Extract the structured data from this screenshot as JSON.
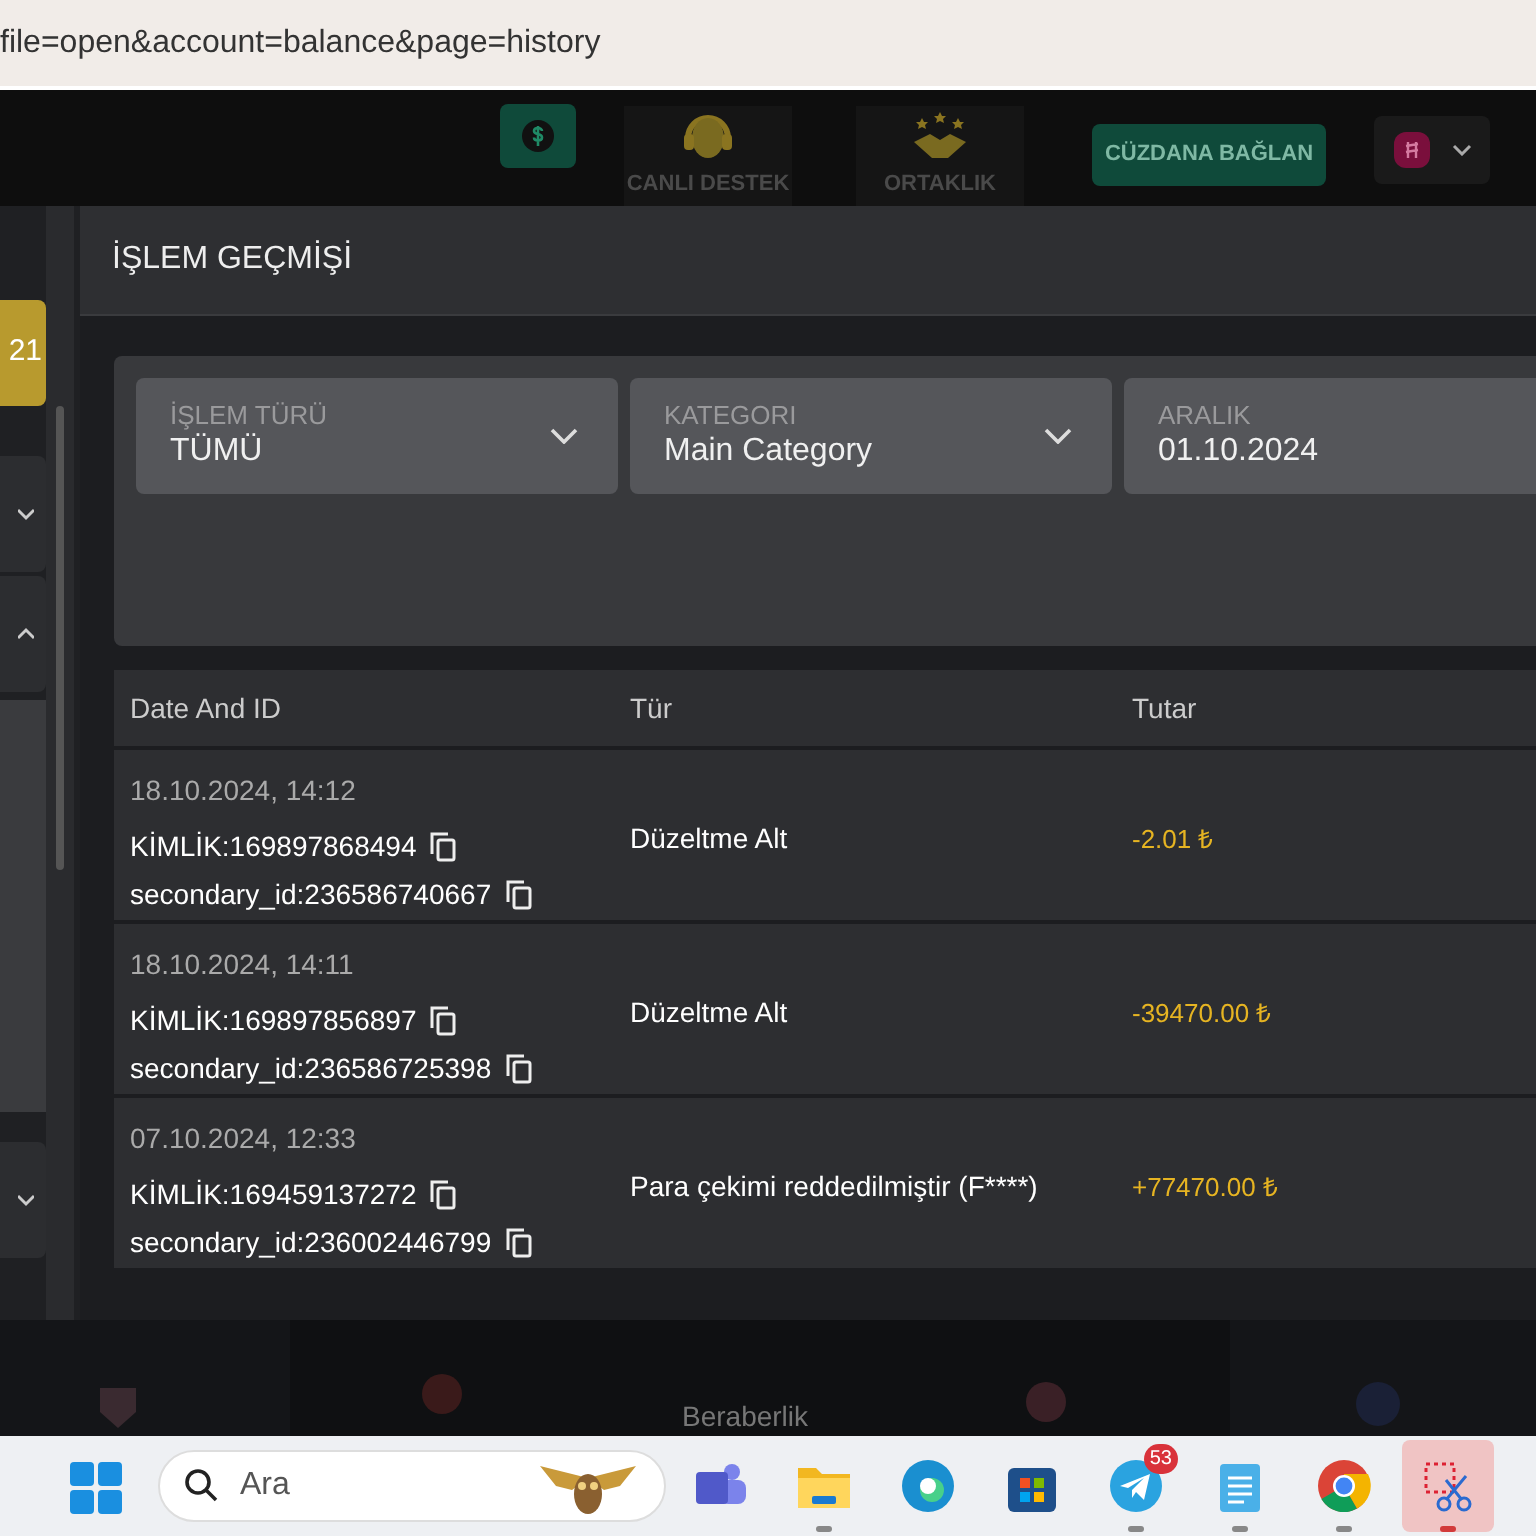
{
  "address_bar": {
    "url": "file=open&account=balance&page=history"
  },
  "header": {
    "nav": [
      {
        "kind": "support",
        "label": "CANLI DESTEK"
      },
      {
        "kind": "partner",
        "label": "ORTAKLIK"
      }
    ],
    "wallet_button": "CÜZDANA BAĞLAN"
  },
  "sidebar": {
    "items": [
      {
        "kind": "highlight",
        "label": "21"
      },
      {
        "kind": "group",
        "expanded": false
      },
      {
        "kind": "group",
        "expanded": true
      },
      {
        "kind": "group",
        "expanded": false
      }
    ]
  },
  "page_title": "İŞLEM GEÇMİŞİ",
  "filters": [
    {
      "kind": "select",
      "label": "İŞLEM TÜRÜ",
      "value": "TÜMÜ"
    },
    {
      "kind": "select",
      "label": "KATEGORI",
      "value": "Main Category"
    },
    {
      "kind": "date",
      "label": "ARALIK",
      "value": "01.10.2024"
    }
  ],
  "table": {
    "columns": [
      "Date And ID",
      "Tür",
      "Tutar"
    ],
    "rows": [
      {
        "date": "18.10.2024, 14:12",
        "id": "KİMLİK:169897868494",
        "secondary_id": "secondary_id:236586740667",
        "type": "Düzeltme Alt",
        "amount": "-2.01 ₺"
      },
      {
        "date": "18.10.2024, 14:11",
        "id": "KİMLİK:169897856897",
        "secondary_id": "secondary_id:236586725398",
        "type": "Düzeltme Alt",
        "amount": "-39470.00 ₺"
      },
      {
        "date": "07.10.2024, 12:33",
        "id": "KİMLİK:169459137272",
        "secondary_id": "secondary_id:236002446799",
        "type": "Para çekimi reddedilmiştir (F****)",
        "amount": "+77470.00 ₺"
      }
    ]
  },
  "match_strip": {
    "label": "Beraberlik"
  },
  "taskbar": {
    "search_placeholder": "Ara",
    "apps": [
      {
        "kind": "teams",
        "running": false,
        "selected": false
      },
      {
        "kind": "files",
        "running": true,
        "selected": false
      },
      {
        "kind": "edge",
        "running": false,
        "selected": false
      },
      {
        "kind": "store",
        "running": false,
        "selected": false
      },
      {
        "kind": "telegram",
        "running": true,
        "selected": false,
        "badge": "53"
      },
      {
        "kind": "notepad",
        "running": true,
        "selected": false
      },
      {
        "kind": "chrome",
        "running": true,
        "selected": false
      },
      {
        "kind": "snip",
        "running": true,
        "selected": true
      }
    ]
  }
}
